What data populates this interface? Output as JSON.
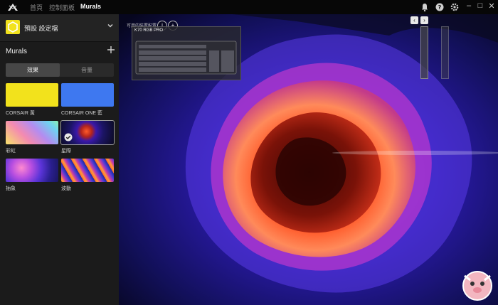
{
  "titlebar": {
    "tabs": [
      {
        "label": "首頁",
        "active": false
      },
      {
        "label": "控制面板",
        "active": false
      },
      {
        "label": "Murals",
        "active": true
      }
    ],
    "icons": [
      "bell-icon",
      "help-icon",
      "gear-icon"
    ],
    "window_controls": [
      "minimize",
      "restore",
      "close"
    ]
  },
  "sidebar": {
    "profile": {
      "name": "預設 設定檔",
      "icon_color": "#f2e21c"
    },
    "section_title": "Murals",
    "segment": [
      {
        "label": "效果",
        "active": true
      },
      {
        "label": "音量",
        "active": false
      }
    ],
    "effects": [
      {
        "label": "CORSAIR 黃",
        "swatch": "#f2e21c"
      },
      {
        "label": "CORSAIR ONE 藍",
        "swatch": "#3e78f0"
      },
      {
        "label": "彩虹",
        "swatch": "rainbow"
      },
      {
        "label": "星際",
        "swatch": "space",
        "selected": true
      },
      {
        "label": "抽象",
        "swatch": "abstract"
      },
      {
        "label": "波動",
        "swatch": "wave"
      }
    ]
  },
  "canvas": {
    "device_group_label": "可用的裝置配置",
    "device": {
      "name": "K70 RGB PRO"
    }
  },
  "colors": {
    "accent": "#f2e21c",
    "sidebar_bg": "#1b1b1b",
    "titlebar_bg": "#070707"
  }
}
